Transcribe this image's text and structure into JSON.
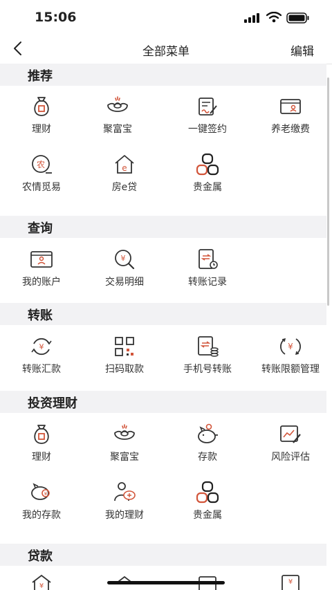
{
  "status_bar": {
    "time": "15:06"
  },
  "nav": {
    "title": "全部菜单",
    "edit": "编辑"
  },
  "sections": [
    {
      "title": "推荐",
      "items": [
        {
          "label": "理财",
          "icon": "money-bag-icon"
        },
        {
          "label": "聚富宝",
          "icon": "gold-ingot-icon"
        },
        {
          "label": "一键签约",
          "icon": "sign-document-icon"
        },
        {
          "label": "养老缴费",
          "icon": "pension-card-icon"
        },
        {
          "label": "农情觅易",
          "icon": "agriculture-icon"
        },
        {
          "label": "房e贷",
          "icon": "house-loan-icon"
        },
        {
          "label": "贵金属",
          "icon": "precious-metal-icon"
        }
      ]
    },
    {
      "title": "查询",
      "items": [
        {
          "label": "我的账户",
          "icon": "account-card-icon"
        },
        {
          "label": "交易明细",
          "icon": "transaction-search-icon"
        },
        {
          "label": "转账记录",
          "icon": "transfer-record-icon"
        }
      ]
    },
    {
      "title": "转账",
      "items": [
        {
          "label": "转账汇款",
          "icon": "transfer-cycle-icon"
        },
        {
          "label": "扫码取款",
          "icon": "qr-code-icon"
        },
        {
          "label": "手机号转账",
          "icon": "phone-transfer-icon"
        },
        {
          "label": "转账限额管理",
          "icon": "transfer-limit-icon"
        }
      ]
    },
    {
      "title": "投资理财",
      "items": [
        {
          "label": "理财",
          "icon": "money-bag-icon"
        },
        {
          "label": "聚富宝",
          "icon": "gold-ingot-icon"
        },
        {
          "label": "存款",
          "icon": "piggy-bank-icon"
        },
        {
          "label": "风险评估",
          "icon": "risk-assessment-icon"
        },
        {
          "label": "我的存款",
          "icon": "my-deposit-icon"
        },
        {
          "label": "我的理财",
          "icon": "my-finance-icon"
        },
        {
          "label": "贵金属",
          "icon": "precious-metal-icon"
        }
      ]
    },
    {
      "title": "贷款",
      "items": []
    }
  ]
}
